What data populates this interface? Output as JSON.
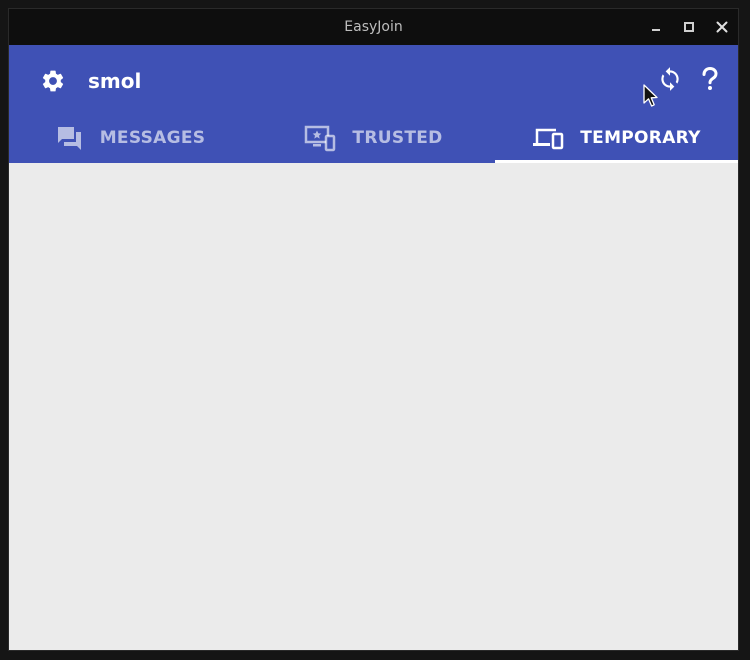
{
  "window": {
    "title": "EasyJoin"
  },
  "window_controls": {
    "minimize_icon": "minimize-icon",
    "maximize_icon": "maximize-icon",
    "close_icon": "close-icon"
  },
  "appbar": {
    "background_color": "#3f51b5",
    "settings_icon": "gear-icon",
    "device_name": "smol",
    "refresh_icon": "sync-icon",
    "help_icon": "help-icon"
  },
  "tabs": [
    {
      "label": "MESSAGES",
      "icon": "chat-bubbles-icon",
      "active": false
    },
    {
      "label": "TRUSTED",
      "icon": "trusted-devices-icon",
      "active": false
    },
    {
      "label": "TEMPORARY",
      "icon": "devices-icon",
      "active": true
    }
  ],
  "colors": {
    "accent": "#3f51b5",
    "indicator": "#ffffff",
    "content_background": "#ebebeb",
    "titlebar": "#0e0e0e"
  }
}
